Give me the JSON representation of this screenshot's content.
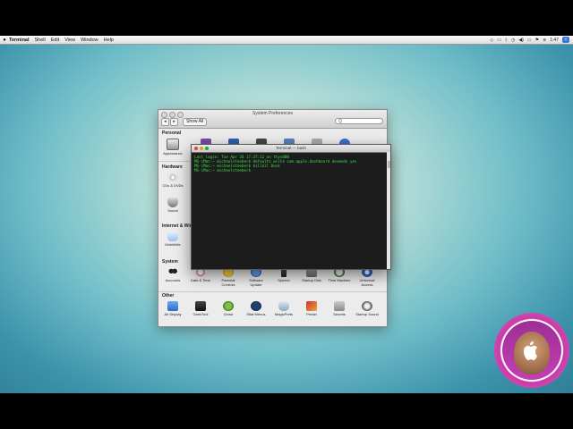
{
  "menubar": {
    "apple_icon": "apple-logo-icon",
    "items": [
      "Terminal",
      "Shell",
      "Edit",
      "View",
      "Window",
      "Help"
    ],
    "status_icons": [
      "dropbox-icon",
      "display-icon",
      "bluetooth-icon",
      "time-machine-icon",
      "volume-icon",
      "battery-icon",
      "flag-icon",
      "wifi-icon",
      "spotlight-icon"
    ],
    "clock": "1:47"
  },
  "system_preferences": {
    "title": "System Preferences",
    "show_all": "Show All",
    "search_placeholder": "Q",
    "sections": {
      "personal": "Personal",
      "hardware": "Hardware",
      "internet": "Internet & Wireless",
      "system": "System",
      "other": "Other"
    },
    "personal_panes": [
      "Appearance"
    ],
    "hardware_panes": [
      "CDs & DVDs",
      "Sound"
    ],
    "internet_panes": [
      "MobileMe"
    ],
    "system_panes": [
      "Accounts",
      "Date & Time",
      "Parental Controls",
      "Software Update",
      "Speech",
      "Startup Disk",
      "Time Machine",
      "Universal Access"
    ],
    "other_panes": [
      "Air Display",
      "GeekTool",
      "Growl",
      "iStat Menus",
      "MagicPrefs",
      "Perian",
      "Secrets",
      "Startup Sound"
    ]
  },
  "terminal": {
    "title": "Terminal — bash",
    "lines": [
      "Last login: Tue Apr 26 17:37:12 on ttys000",
      "MS-iMac:~ michaelsteeber$ defaults write com.apple.dashboard devmode yes",
      "MS-iMac:~ michaelsteeber$ killall Dock",
      "MS-iMac:~ michaelsteeber$ "
    ]
  },
  "colors": {
    "terminal_text": "#3ae24a",
    "close": "#e0443e",
    "minimize": "#dea123",
    "zoom": "#1aab29"
  }
}
